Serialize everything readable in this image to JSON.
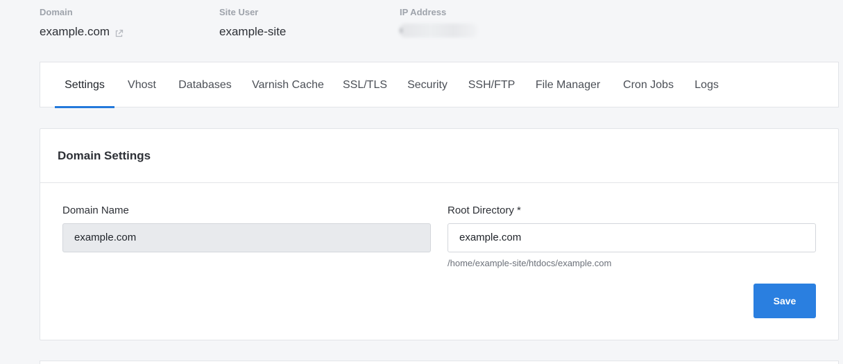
{
  "header": {
    "domain": {
      "label": "Domain",
      "value": "example.com"
    },
    "site_user": {
      "label": "Site User",
      "value": "example-site"
    },
    "ip_address": {
      "label": "IP Address"
    }
  },
  "tabs": [
    {
      "label": "Settings",
      "active": true
    },
    {
      "label": "Vhost"
    },
    {
      "label": "Databases"
    },
    {
      "label": "Varnish Cache"
    },
    {
      "label": "SSL/TLS"
    },
    {
      "label": "Security"
    },
    {
      "label": "SSH/FTP"
    },
    {
      "label": "File Manager"
    },
    {
      "label": "Cron Jobs"
    },
    {
      "label": "Logs"
    }
  ],
  "domain_settings": {
    "title": "Domain Settings",
    "domain_name": {
      "label": "Domain Name",
      "value": "example.com"
    },
    "root_directory": {
      "label": "Root Directory *",
      "value": "example.com",
      "hint": "/home/example-site/htdocs/example.com"
    },
    "save_label": "Save"
  },
  "colors": {
    "accent": "#2a7fe0",
    "tab_underline": "#2379db"
  }
}
